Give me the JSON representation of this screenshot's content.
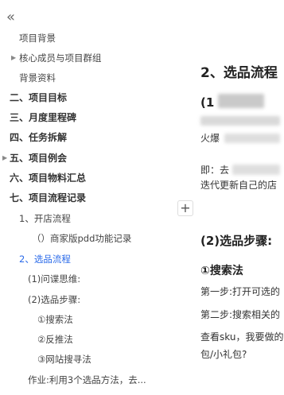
{
  "sidebar": {
    "collapse_icon": "«",
    "items": [
      {
        "label": "项目背景"
      },
      {
        "label": "核心成员与项目群组"
      },
      {
        "label": "背景资料"
      },
      {
        "label": "二、项目目标"
      },
      {
        "label": "三、月度里程碑"
      },
      {
        "label": "四、任务拆解"
      },
      {
        "label": "五、项目例会"
      },
      {
        "label": "六、项目物料汇总"
      },
      {
        "label": "七、项目流程记录"
      },
      {
        "label": "1、开店流程"
      },
      {
        "label": "（）商家版pdd功能记录"
      },
      {
        "label": "2、选品流程"
      },
      {
        "label": "(1)问谍思维:"
      },
      {
        "label": "(2)选品步骤:"
      },
      {
        "label": "①搜索法"
      },
      {
        "label": "②反推法"
      },
      {
        "label": "③网站搜寻法"
      },
      {
        "label": "作业:利用3个选品方法，去..."
      }
    ]
  },
  "content": {
    "heading": "2、选品流程",
    "subheading_1_prefix": "(1",
    "line_fragment_1": "火爆",
    "line_fragment_2": "即：去",
    "line_fragment_3": "迭代更新自己的店",
    "subheading_2": "(2)选品步骤:",
    "subheading_3": "①搜索法",
    "step_1": "第一步:打开可选的",
    "step_2": "第二步:搜索相关的",
    "sku_line_1": "查看sku，我要做的",
    "sku_line_2": "包/小礼包?",
    "add_button": "+"
  },
  "colors": {
    "active": "#2a6ae9"
  }
}
